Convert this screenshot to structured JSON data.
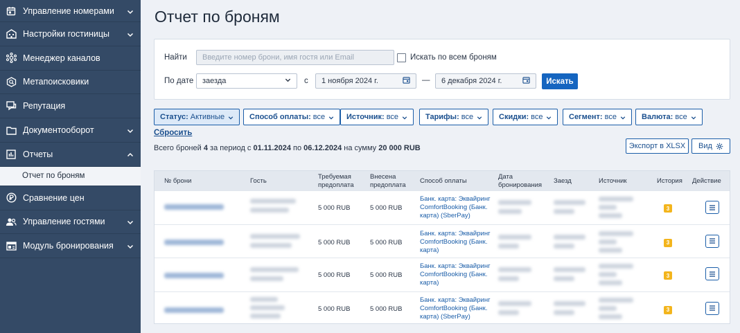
{
  "sidebar": {
    "items": [
      {
        "label": "Управление номерами",
        "icon": "calendar-icon",
        "expand": "down"
      },
      {
        "label": "Настройки гостиницы",
        "icon": "building-icon",
        "expand": "down"
      },
      {
        "label": "Менеджер каналов",
        "icon": "network-icon",
        "expand": ""
      },
      {
        "label": "Метапоисковики",
        "icon": "metasearch-icon",
        "expand": ""
      },
      {
        "label": "Репутация",
        "icon": "chat-icon",
        "expand": ""
      },
      {
        "label": "Документооборот",
        "icon": "folder-icon",
        "expand": "down"
      },
      {
        "label": "Отчеты",
        "icon": "report-chart-icon",
        "expand": "up"
      },
      {
        "label": "Сравнение цен",
        "icon": "price-compare-icon",
        "expand": ""
      },
      {
        "label": "Управление гостями",
        "icon": "users-icon",
        "expand": "down"
      },
      {
        "label": "Модуль бронирования",
        "icon": "booking-module-icon",
        "expand": "down"
      }
    ],
    "subitem": "Отчет по броням"
  },
  "page": {
    "title": "Отчет по броням"
  },
  "search": {
    "find_label": "Найти",
    "find_placeholder": "Введите номер брони, имя гостя или Email",
    "all_bookings_label": "Искать по всем броням",
    "date_label": "По дате",
    "date_type": "заезда",
    "from_label": "с",
    "date_from": "1 ноября 2024 г.",
    "dash": "—",
    "date_to": "6 декабря 2024 г.",
    "search_button": "Искать"
  },
  "filters": [
    {
      "name": "Статус:",
      "value": "Активные",
      "active": true
    },
    {
      "name": "Способ оплаты:",
      "value": "все",
      "active": false
    },
    {
      "name": "Источник:",
      "value": "все",
      "active": false
    },
    {
      "name": "Тарифы:",
      "value": "все",
      "active": false
    },
    {
      "name": "Скидки:",
      "value": "все",
      "active": false
    },
    {
      "name": "Сегмент:",
      "value": "все",
      "active": false
    },
    {
      "name": "Валюта:",
      "value": "все",
      "active": false
    }
  ],
  "reset_label": "Сбросить",
  "summary": {
    "prefix": "Всего броней",
    "count": "4",
    "period_text": "за период с",
    "from": "01.11.2024",
    "to_text": "по",
    "to": "06.12.2024",
    "sum_text": "на сумму",
    "sum": "20 000 RUB"
  },
  "export_button": "Экспорт в XLSX",
  "view_button": "Вид",
  "table": {
    "headers": {
      "number": "№ брони",
      "guest": "Гость",
      "required_1": "Требуемая",
      "required_2": "предоплата",
      "paid_1": "Внесена",
      "paid_2": "предоплата",
      "payment": "Способ оплаты",
      "date_1": "Дата",
      "date_2": "бронирования",
      "checkin": "Заезд",
      "source": "Источник",
      "history": "История",
      "action": "Действие"
    },
    "rows": [
      {
        "required": "5 000 RUB",
        "paid": "5 000 RUB",
        "payment": [
          "Банк. карта: Эквайринг",
          "ComfortBooking (Банк.",
          "карта) (SberPay)"
        ],
        "history": "3"
      },
      {
        "required": "5 000 RUB",
        "paid": "5 000 RUB",
        "payment": [
          "Банк. карта: Эквайринг",
          "ComfortBooking (Банк.",
          "карта)"
        ],
        "history": "3"
      },
      {
        "required": "5 000 RUB",
        "paid": "5 000 RUB",
        "payment": [
          "Банк. карта: Эквайринг",
          "ComfortBooking (Банк.",
          "карта)"
        ],
        "history": "3"
      },
      {
        "required": "5 000 RUB",
        "paid": "5 000 RUB",
        "payment": [
          "Банк. карта: Эквайринг",
          "ComfortBooking (Банк.",
          "карта) (SberPay)"
        ],
        "history": "3"
      }
    ]
  },
  "colors": {
    "sidebar": "#344a66",
    "accent": "#1565c0",
    "history_badge": "#f3b51d",
    "background": "#eef1f6"
  }
}
